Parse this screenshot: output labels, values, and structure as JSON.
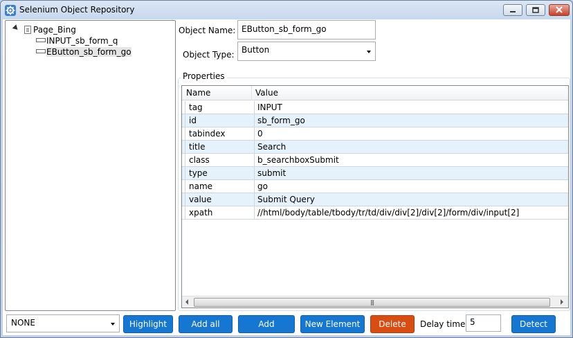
{
  "window": {
    "title": "Selenium Object Repository",
    "accent": "#1577d2",
    "danger": "#d94d13"
  },
  "tree": {
    "root": "Page_Bing",
    "children": [
      "INPUT_sb_form_q",
      "EButton_sb_form_go"
    ],
    "selected": "EButton_sb_form_go"
  },
  "form": {
    "object_name_label": "Object Name:",
    "object_name_value": "EButton_sb_form_go",
    "object_type_label": "Object Type:",
    "object_type_value": "Button"
  },
  "properties": {
    "group_title": "Properties",
    "columns": [
      "Name",
      "Value"
    ],
    "rows": [
      {
        "name": "tag",
        "value": "INPUT"
      },
      {
        "name": "id",
        "value": "sb_form_go"
      },
      {
        "name": "tabindex",
        "value": "0"
      },
      {
        "name": "title",
        "value": "Search"
      },
      {
        "name": "class",
        "value": "b_searchboxSubmit"
      },
      {
        "name": "type",
        "value": "submit"
      },
      {
        "name": "name",
        "value": "go"
      },
      {
        "name": "value",
        "value": "Submit Query"
      },
      {
        "name": "xpath",
        "value": "//html/body/table/tbody/tr/td/div/div[2]/div[2]/form/div/input[2]"
      }
    ]
  },
  "bottom": {
    "dropdown_value": "NONE",
    "buttons": {
      "highlight": "Highlight",
      "add_all": "Add all",
      "add": "Add",
      "new_element": "New Element",
      "delete": "Delete",
      "detect": "Detect"
    },
    "delay_label": "Delay time:",
    "delay_value": "5"
  },
  "icons": {
    "app": "gear-icon",
    "minimize": "minimize-icon",
    "maximize": "maximize-icon",
    "close": "close-icon",
    "tree_expand": "expand-arrow-icon",
    "page": "page-icon",
    "element": "element-icon",
    "dropdown": "chevron-down-icon",
    "scroll_left": "scroll-left-icon",
    "scroll_right": "scroll-right-icon"
  }
}
